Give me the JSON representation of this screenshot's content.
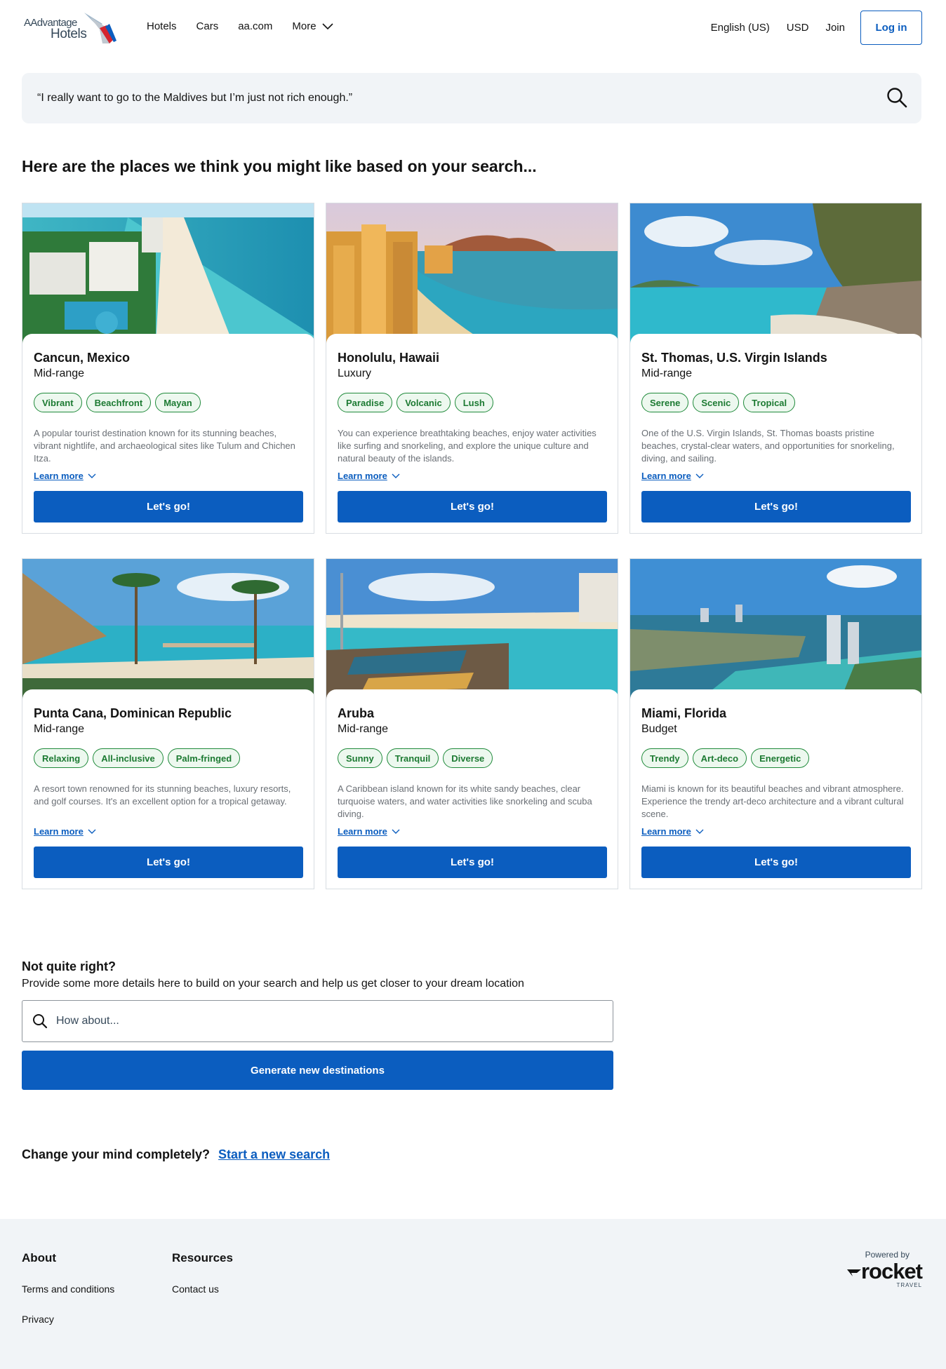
{
  "header": {
    "logo_line1": "AAdvantage",
    "logo_line2": "Hotels",
    "nav": [
      "Hotels",
      "Cars",
      "aa.com",
      "More"
    ],
    "language": "English (US)",
    "currency": "USD",
    "join": "Join",
    "login": "Log in"
  },
  "search": {
    "query": "“I really want to go to the Maldives but I’m just not rich enough.”"
  },
  "heading": "Here are the places we think you might like based on your search...",
  "learn_more_label": "Learn more",
  "go_label": "Let's go!",
  "cards": [
    {
      "title": "Cancun, Mexico",
      "price": "Mid-range",
      "tags": [
        "Vibrant",
        "Beachfront",
        "Mayan"
      ],
      "desc": "A popular tourist destination known for its stunning beaches, vibrant nightlife, and archaeological sites like Tulum and Chichen Itza."
    },
    {
      "title": "Honolulu, Hawaii",
      "price": "Luxury",
      "tags": [
        "Paradise",
        "Volcanic",
        "Lush"
      ],
      "desc": "You can experience breathtaking beaches, enjoy water activities like surfing and snorkeling, and explore the unique culture and natural beauty of the islands."
    },
    {
      "title": "St. Thomas, U.S. Virgin Islands",
      "price": "Mid-range",
      "tags": [
        "Serene",
        "Scenic",
        "Tropical"
      ],
      "desc": "One of the U.S. Virgin Islands, St. Thomas boasts pristine beaches, crystal-clear waters, and opportunities for snorkeling, diving, and sailing."
    },
    {
      "title": "Punta Cana, Dominican Republic",
      "price": "Mid-range",
      "tags": [
        "Relaxing",
        "All-inclusive",
        "Palm-fringed"
      ],
      "desc": "A resort town renowned for its stunning beaches, luxury resorts, and golf courses. It's an excellent option for a tropical getaway."
    },
    {
      "title": "Aruba",
      "price": "Mid-range",
      "tags": [
        "Sunny",
        "Tranquil",
        "Diverse"
      ],
      "desc": "A Caribbean island known for its white sandy beaches, clear turquoise waters, and water activities like snorkeling and scuba diving."
    },
    {
      "title": "Miami, Florida",
      "price": "Budget",
      "tags": [
        "Trendy",
        "Art-deco",
        "Energetic"
      ],
      "desc": "Miami is known for its beautiful beaches and vibrant atmosphere. Experience the trendy art-deco architecture and a vibrant cultural scene."
    }
  ],
  "refine": {
    "title": "Not quite right?",
    "subtitle": "Provide some more details here to build on your search and help us get closer to your dream location",
    "placeholder": "How about...",
    "button": "Generate new destinations"
  },
  "change": {
    "text": "Change your mind completely?",
    "link": "Start a new search"
  },
  "footer": {
    "about_title": "About",
    "about_links": [
      "Terms and conditions",
      "Privacy"
    ],
    "resources_title": "Resources",
    "resources_links": [
      "Contact us"
    ],
    "powered_by": "Powered by",
    "brand": "rocket",
    "brand_sub": "TRAVEL"
  },
  "colors": {
    "primary": "#0b5dbf",
    "tag_green": "#1c7a32",
    "tag_bg": "#edf8ef",
    "search_bg": "#f1f4f7"
  }
}
